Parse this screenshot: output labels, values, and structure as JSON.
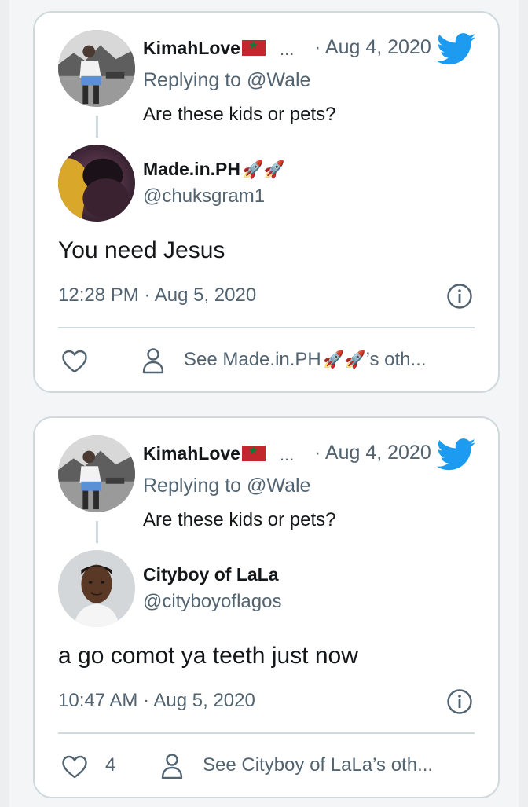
{
  "colors": {
    "twitter_blue": "#1d9bf0",
    "text_primary": "#14171a",
    "text_secondary": "#536471",
    "border": "#cfd9de"
  },
  "icons": {
    "twitter": "twitter-bird-icon",
    "info": "info-icon",
    "like": "heart-icon",
    "profile": "person-icon",
    "flag": "morocco-flag-icon",
    "emoji": "rocket-emoji"
  },
  "cards": [
    {
      "parent": {
        "name": "KimahLove",
        "ellipsis": "...",
        "date": "· Aug 4, 2020",
        "replying_to": "Replying to @Wale",
        "text": "Are these kids or pets?"
      },
      "reply": {
        "name": "Made.in.PH",
        "name_emoji": "🚀🚀",
        "handle": "@chuksgram1",
        "text": "You need Jesus",
        "timestamp": "12:28 PM · Aug 5, 2020",
        "like_count": "",
        "see_more_prefix": "See Made.in.PH",
        "see_more_emoji": "🚀🚀",
        "see_more_suffix": "’s oth..."
      }
    },
    {
      "parent": {
        "name": "KimahLove",
        "ellipsis": "...",
        "date": "· Aug 4, 2020",
        "replying_to": "Replying to @Wale",
        "text": "Are these kids or pets?"
      },
      "reply": {
        "name": "Cityboy of LaLa",
        "name_emoji": "",
        "handle": "@cityboyoflagos",
        "text": "a go comot ya teeth just now",
        "timestamp": "10:47 AM · Aug 5, 2020",
        "like_count": "4",
        "see_more_prefix": "See Cityboy of LaLa’s oth...",
        "see_more_emoji": "",
        "see_more_suffix": ""
      }
    }
  ]
}
